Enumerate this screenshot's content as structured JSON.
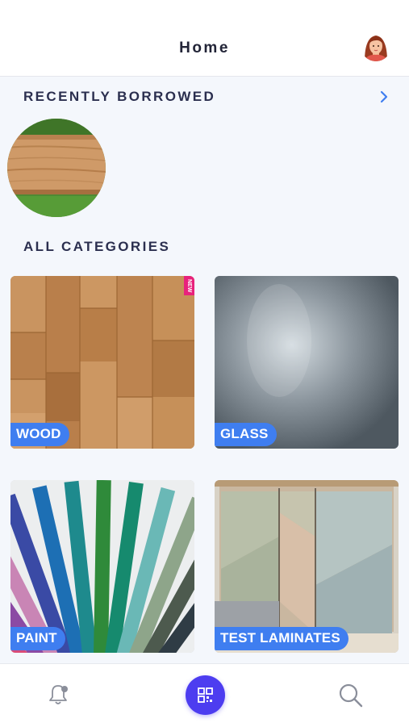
{
  "header": {
    "title": "Home",
    "profile_icon": "avatar-woman"
  },
  "recent": {
    "title": "RECENTLY BORROWED",
    "more_icon": "chevron-right-icon",
    "accent": "#3f7ef0",
    "items": [
      {
        "icon": "wood-plank-on-grass"
      }
    ]
  },
  "categories": {
    "title": "ALL CATEGORIES",
    "badge_new": "NEW",
    "items": [
      {
        "label": "WOOD"
      },
      {
        "label": "GLASS"
      },
      {
        "label": "PAINT"
      },
      {
        "label": "TEST LAMINATES"
      }
    ]
  },
  "tabbar": {
    "notifications_icon": "bell-icon",
    "scan_icon": "qr-code-icon",
    "search_icon": "search-icon",
    "scan_color": "#4d3df0"
  }
}
